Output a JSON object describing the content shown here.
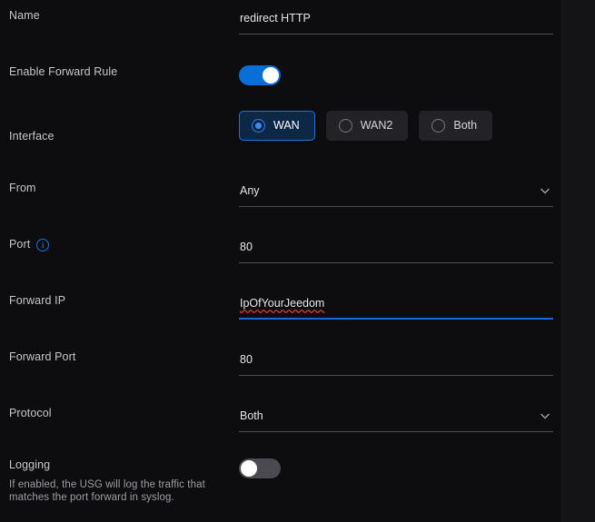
{
  "form": {
    "rows": [
      {
        "label": "Name",
        "type": "text",
        "value": "redirect HTTP",
        "name": "name"
      },
      {
        "label": "Enable Forward Rule",
        "type": "toggle",
        "state": "on",
        "name": "enable-forward-rule"
      },
      {
        "label": "Interface",
        "type": "radio-pills",
        "name": "interface",
        "options": [
          {
            "label": "WAN",
            "selected": true
          },
          {
            "label": "WAN2",
            "selected": false
          },
          {
            "label": "Both",
            "selected": false
          }
        ]
      },
      {
        "label": "From",
        "type": "select",
        "value": "Any",
        "name": "from"
      },
      {
        "label": "Port",
        "type": "text",
        "value": "80",
        "name": "port",
        "info_icon": "info-icon",
        "info_glyph": "i"
      },
      {
        "label": "Forward IP",
        "type": "text",
        "value": "IpOfYourJeedom",
        "name": "forward-ip",
        "focused": true,
        "spellcheck_error": true
      },
      {
        "label": "Forward Port",
        "type": "text",
        "value": "80",
        "name": "forward-port"
      },
      {
        "label": "Protocol",
        "type": "select",
        "value": "Both",
        "name": "protocol"
      },
      {
        "label": "Logging",
        "type": "toggle",
        "state": "off",
        "name": "logging",
        "helper": "If enabled, the USG will log the traffic that matches the port forward in syslog."
      }
    ]
  },
  "colors": {
    "background": "#0d0d0f",
    "toggle_on": "#0a6ed8",
    "toggle_off": "#4a4a50",
    "focus_underline": "#1668dc",
    "pill_selected_bg": "#0d2847",
    "pill_selected_border": "#2070dd",
    "spell_error": "#e03b31"
  }
}
